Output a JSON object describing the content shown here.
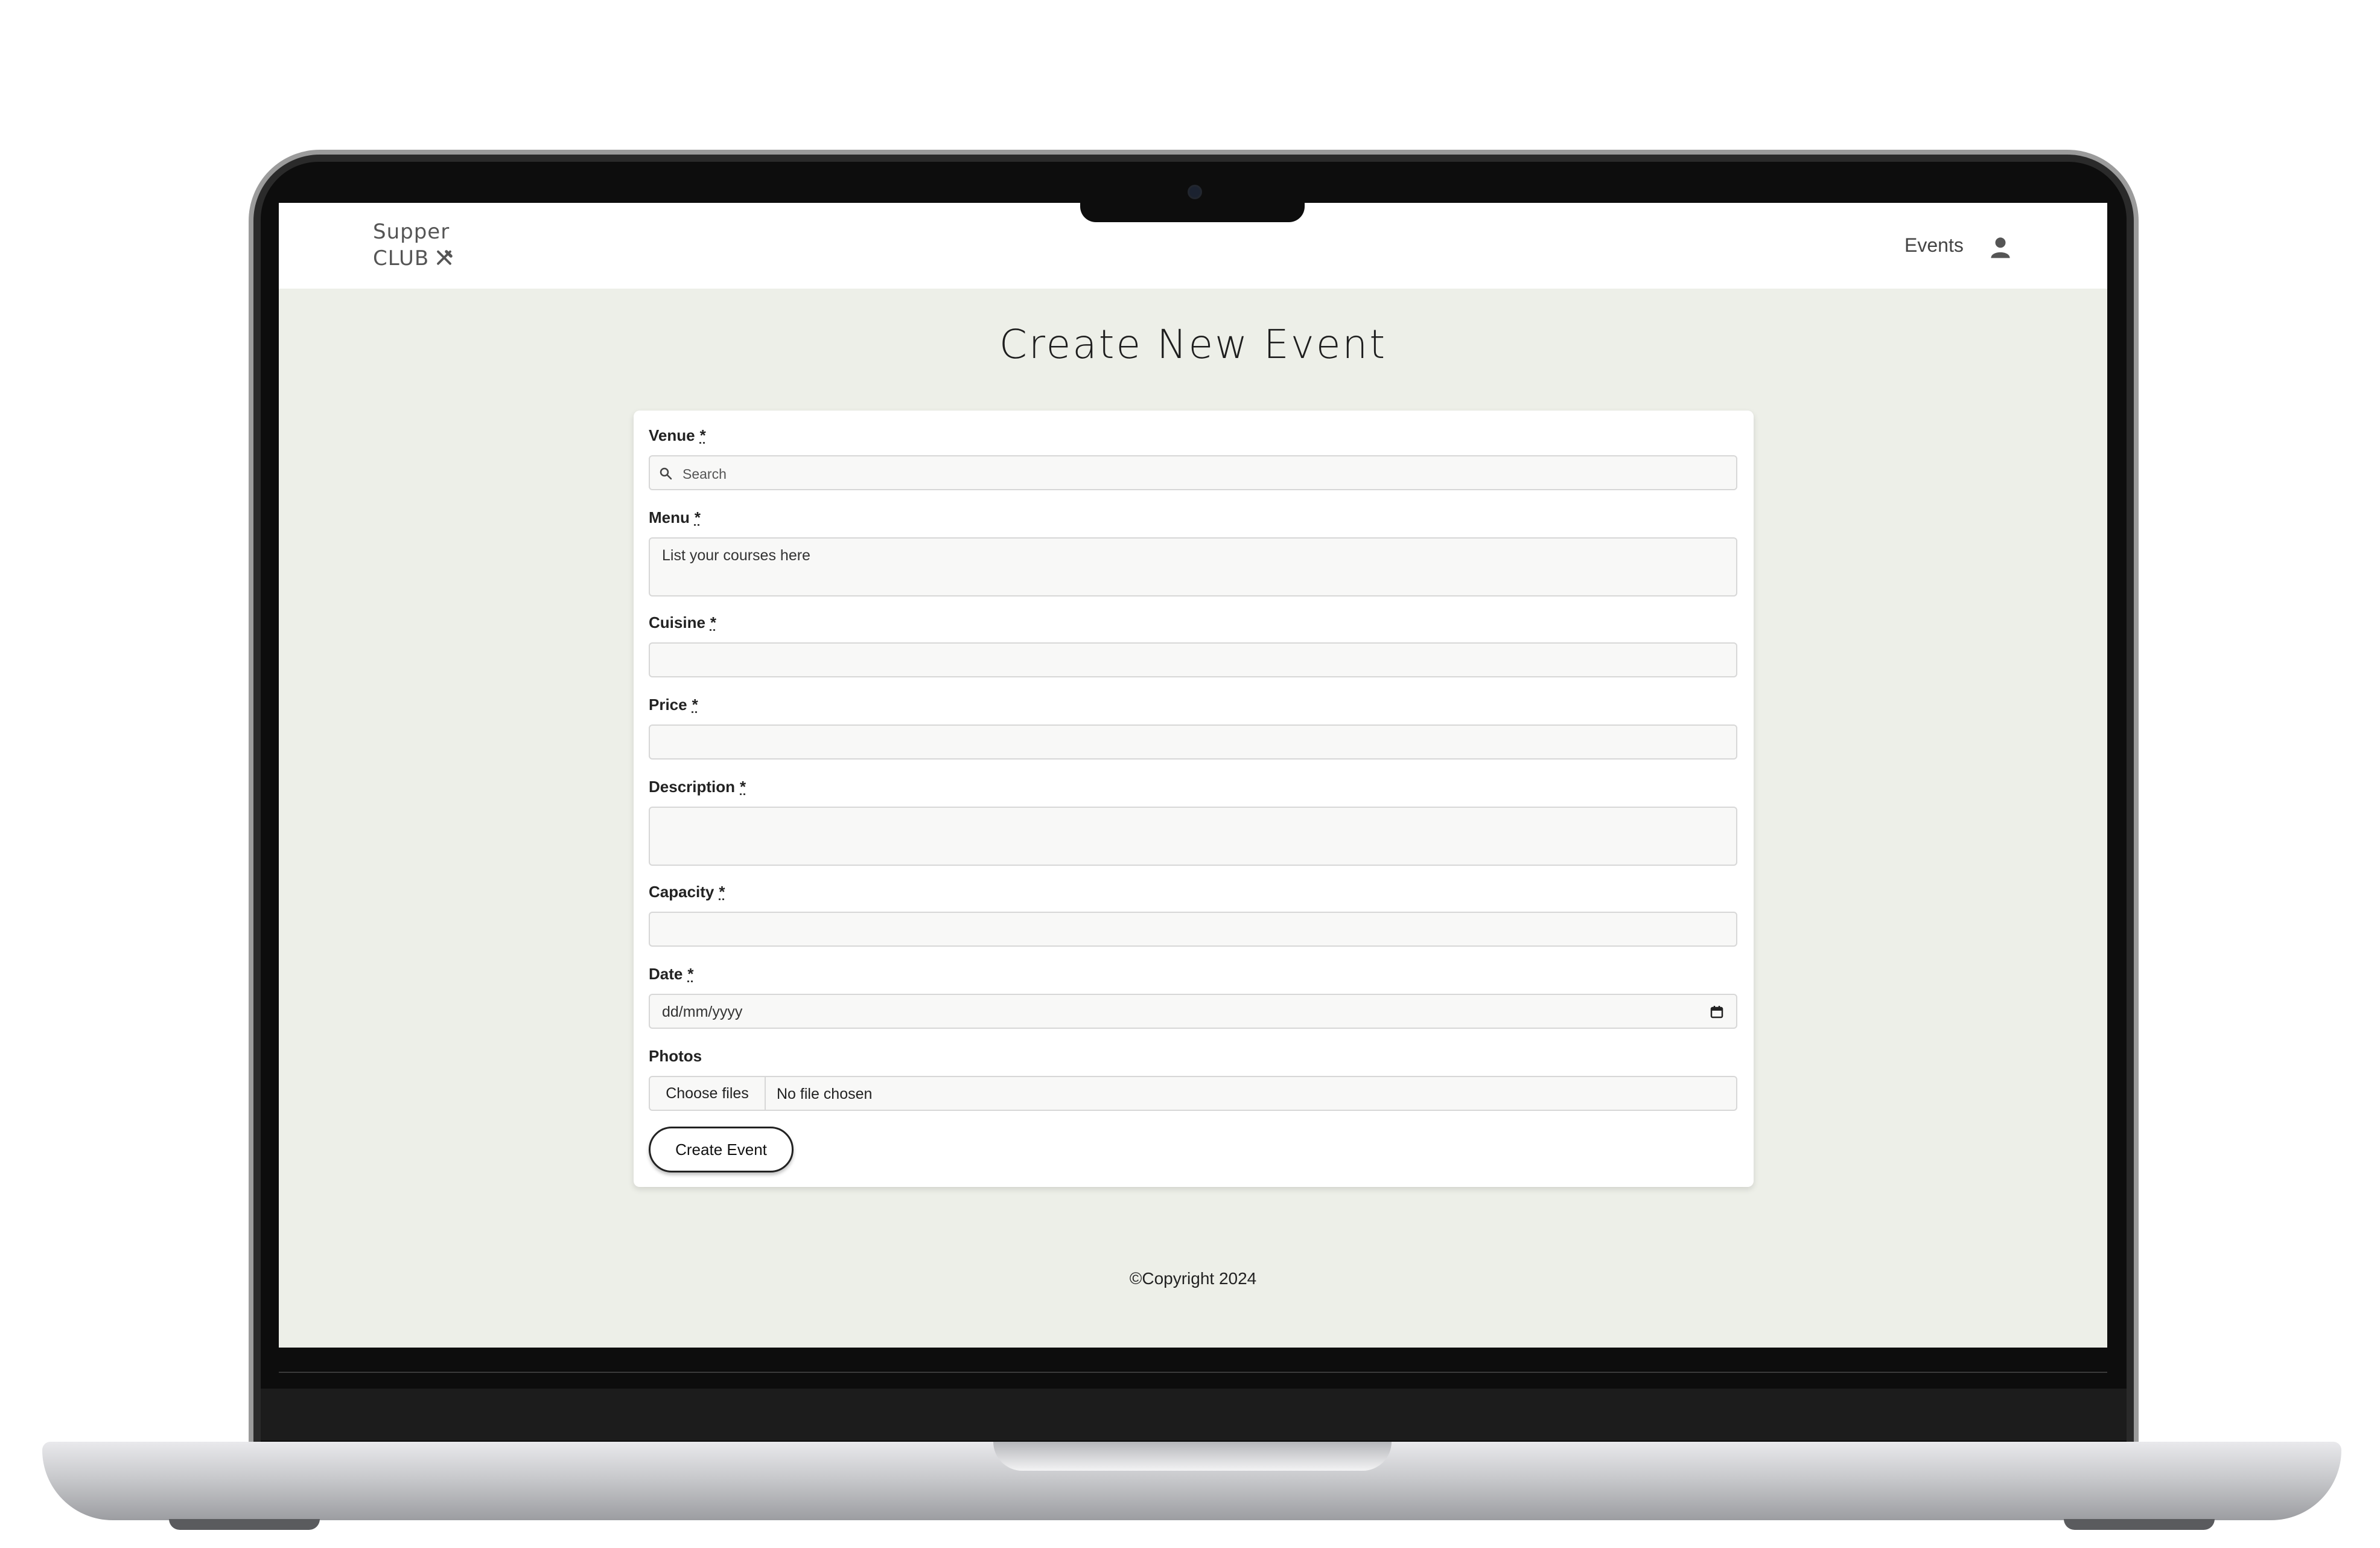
{
  "brand": {
    "line1": "Supper",
    "line2": "CLUB",
    "icon": "fork-knife-icon"
  },
  "nav": {
    "events_label": "Events",
    "user_icon": "user-icon"
  },
  "page": {
    "title": "Create New Event"
  },
  "form": {
    "required_mark": "*",
    "venue": {
      "label": "Venue",
      "placeholder": "Search",
      "icon": "search-icon"
    },
    "menu": {
      "label": "Menu",
      "placeholder": "List your courses here"
    },
    "cuisine": {
      "label": "Cuisine",
      "value": ""
    },
    "price": {
      "label": "Price",
      "value": ""
    },
    "description": {
      "label": "Description",
      "value": ""
    },
    "capacity": {
      "label": "Capacity",
      "value": ""
    },
    "date": {
      "label": "Date",
      "placeholder": "dd/mm/yyyy",
      "icon": "calendar-icon"
    },
    "photos": {
      "label": "Photos",
      "button": "Choose files",
      "status": "No file chosen"
    },
    "submit_label": "Create Event"
  },
  "footer": {
    "copyright": "©Copyright 2024"
  }
}
